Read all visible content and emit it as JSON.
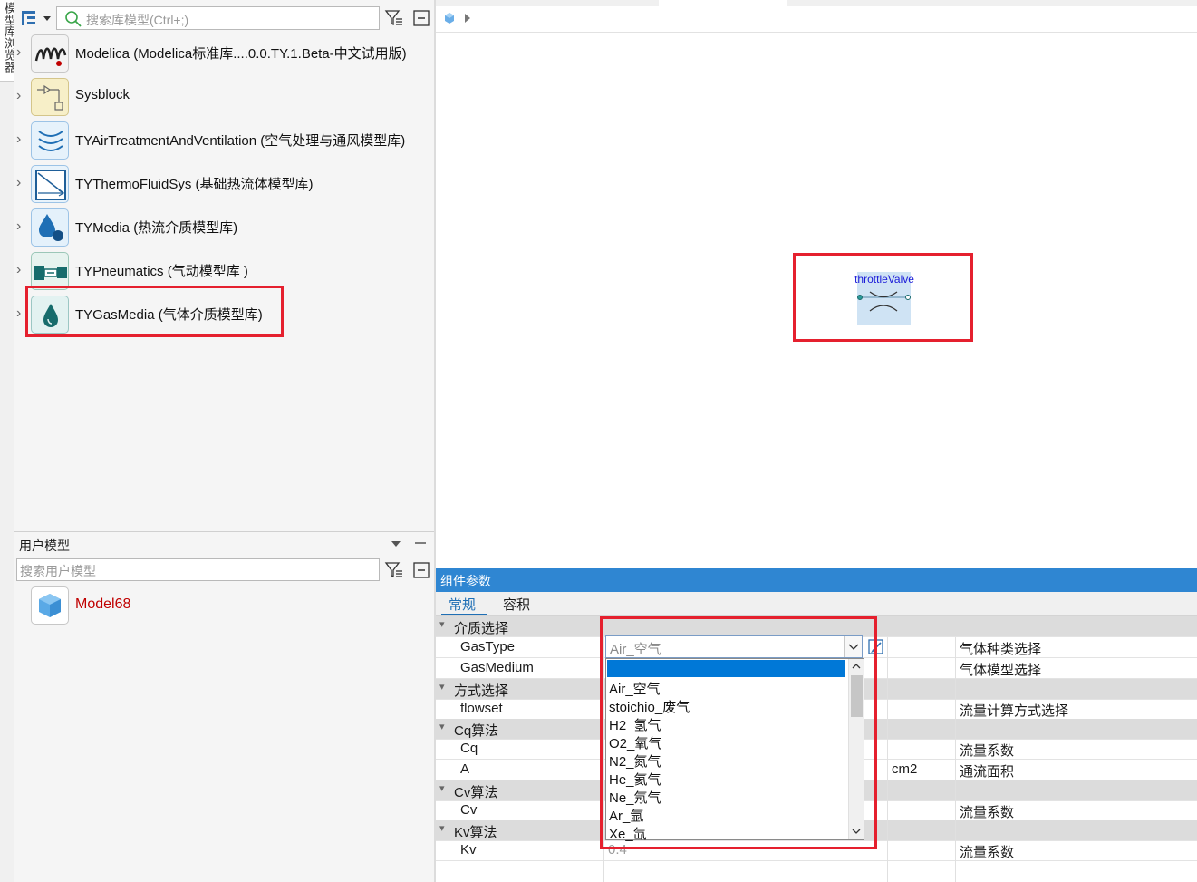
{
  "side_tab": {
    "label": "模型库浏览器"
  },
  "library": {
    "search_placeholder": "搜索库模型(Ctrl+;)",
    "items": [
      {
        "label": "Modelica (Modelica标准库....0.0.TY.1.Beta-中文试用版)",
        "icon": "modelica-icon"
      },
      {
        "label": "Sysblock",
        "icon": "sysblock-icon"
      },
      {
        "label": "TYAirTreatmentAndVentilation (空气处理与通风模型库)",
        "icon": "air-waves-icon"
      },
      {
        "label": "TYThermoFluidSys (基础热流体模型库)",
        "icon": "thermofluid-icon"
      },
      {
        "label": "TYMedia (热流介质模型库)",
        "icon": "media-drops-icon"
      },
      {
        "label": "TYPneumatics (气动模型库 )",
        "icon": "pneumatics-icon"
      },
      {
        "label": "TYGasMedia (气体介质模型库)",
        "icon": "gas-drop-icon"
      }
    ]
  },
  "user_models": {
    "title": "用户模型",
    "search_placeholder": "搜索用户模型",
    "items": [
      {
        "label": "Model68",
        "icon": "model-cube-icon"
      }
    ]
  },
  "canvas": {
    "component_label": "throttleValve"
  },
  "properties": {
    "title": "组件参数",
    "tabs": [
      {
        "label": "常规",
        "active": true
      },
      {
        "label": "容积",
        "active": false
      }
    ],
    "groups": {
      "medium": "介质选择",
      "method": "方式选择",
      "cq": "Cq算法",
      "cv": "Cv算法",
      "kv": "Kv算法"
    },
    "params": {
      "gastype": {
        "name": "GasType",
        "value": "Air_空气",
        "unit": "",
        "desc": "气体种类选择"
      },
      "gasmedium": {
        "name": "GasMedium",
        "unit": "",
        "desc": "气体模型选择"
      },
      "flowset": {
        "name": "flowset",
        "unit": "",
        "desc": "流量计算方式选择"
      },
      "cq": {
        "name": "Cq",
        "unit": "",
        "desc": "流量系数"
      },
      "a": {
        "name": "A",
        "unit": "cm2",
        "desc": "通流面积"
      },
      "cv": {
        "name": "Cv",
        "unit": "",
        "desc": "流量系数"
      },
      "kv": {
        "name": "Kv",
        "value": "0.4",
        "unit": "",
        "desc": "流量系数"
      }
    },
    "dropdown_options": [
      "",
      "Air_空气",
      "stoichio_废气",
      "H2_氢气",
      "O2_氧气",
      "N2_氮气",
      "He_氦气",
      "Ne_氖气",
      "Ar_氩",
      "Xe_氙"
    ]
  },
  "colors": {
    "accent": "#2f86d2",
    "highlight": "#e5202e",
    "selection": "#0078d7",
    "user_model_text": "#c00000"
  }
}
